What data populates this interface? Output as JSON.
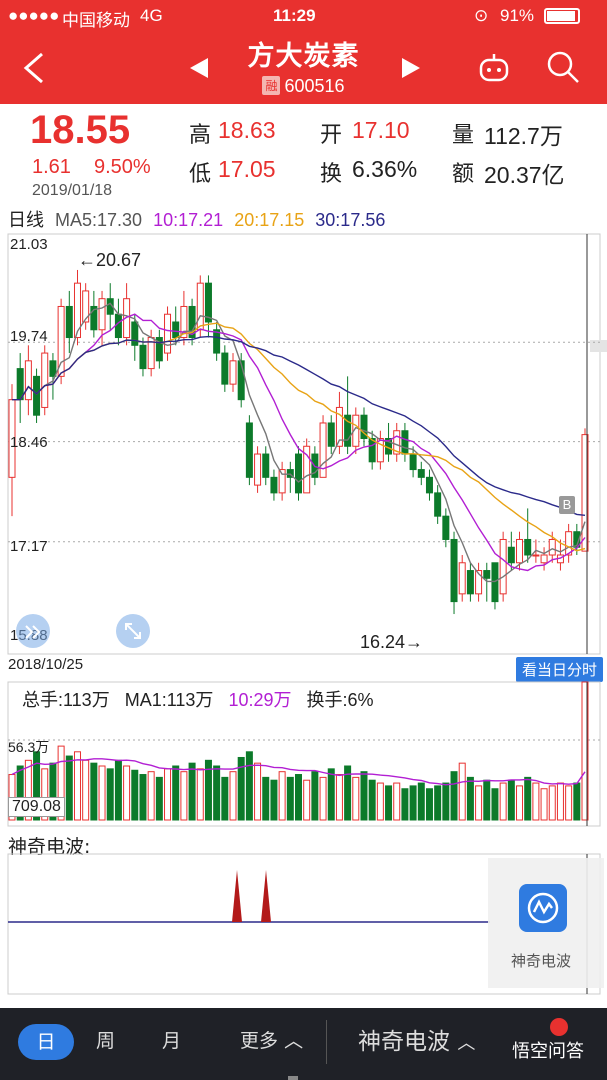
{
  "status_bar": {
    "carrier": "中国移动",
    "network": "4G",
    "time": "11:29",
    "battery": "91%"
  },
  "header": {
    "title": "方大炭素",
    "margin_badge": "融",
    "code": "600516"
  },
  "quote": {
    "price": "18.55",
    "change": "1.61",
    "change_pct": "9.50%",
    "date": "2019/01/18",
    "high_label": "高",
    "high": "18.63",
    "low_label": "低",
    "low": "17.05",
    "open_label": "开",
    "open": "17.10",
    "turnover_label": "换",
    "turnover": "6.36%",
    "volume_label": "量",
    "volume": "112.7万",
    "amount_label": "额",
    "amount": "20.37亿"
  },
  "ma_bar": {
    "period": "日线",
    "ma5": "MA5:17.30",
    "ma10": "10:17.21",
    "ma20": "20:17.15",
    "ma30": "30:17.56"
  },
  "chart_data": {
    "type": "candlestick",
    "y_ticks": [
      "21.03",
      "19.74",
      "18.46",
      "17.17",
      "15.88"
    ],
    "ylim": [
      15.88,
      21.03
    ],
    "annotations": {
      "high": "←20.67",
      "low": "16.24→",
      "marker": "B"
    },
    "start_date": "2018/10/25",
    "candles": [
      [
        18.0,
        19.0,
        19.2,
        17.5
      ],
      [
        19.4,
        19.0,
        19.6,
        18.7
      ],
      [
        19.0,
        19.5,
        19.7,
        18.8
      ],
      [
        19.3,
        18.8,
        19.4,
        18.7
      ],
      [
        18.9,
        19.6,
        19.7,
        18.8
      ],
      [
        19.5,
        19.3,
        19.6,
        19.0
      ],
      [
        19.3,
        20.2,
        20.3,
        19.2
      ],
      [
        20.2,
        19.8,
        20.4,
        19.6
      ],
      [
        19.8,
        20.5,
        20.67,
        19.7
      ],
      [
        20.0,
        20.4,
        20.5,
        19.9
      ],
      [
        20.2,
        19.9,
        20.4,
        19.8
      ],
      [
        19.9,
        20.3,
        20.4,
        19.7
      ],
      [
        20.3,
        20.1,
        20.5,
        19.9
      ],
      [
        20.1,
        19.8,
        20.3,
        19.7
      ],
      [
        19.8,
        20.3,
        20.5,
        19.7
      ],
      [
        20.0,
        19.7,
        20.1,
        19.5
      ],
      [
        19.7,
        19.4,
        19.8,
        19.3
      ],
      [
        19.4,
        19.8,
        19.9,
        19.3
      ],
      [
        19.8,
        19.5,
        19.9,
        19.4
      ],
      [
        19.6,
        20.1,
        20.2,
        19.5
      ],
      [
        20.0,
        19.8,
        20.2,
        19.7
      ],
      [
        19.8,
        20.2,
        20.4,
        19.7
      ],
      [
        20.2,
        19.8,
        20.3,
        19.7
      ],
      [
        19.9,
        20.5,
        20.6,
        19.8
      ],
      [
        20.5,
        20.0,
        20.6,
        19.8
      ],
      [
        19.9,
        19.6,
        20.0,
        19.5
      ],
      [
        19.6,
        19.2,
        19.7,
        19.1
      ],
      [
        19.2,
        19.5,
        19.6,
        19.1
      ],
      [
        19.5,
        19.0,
        19.6,
        18.9
      ],
      [
        18.7,
        18.0,
        18.8,
        17.9
      ],
      [
        17.9,
        18.3,
        18.4,
        17.8
      ],
      [
        18.3,
        18.0,
        18.4,
        17.9
      ],
      [
        18.0,
        17.8,
        18.1,
        17.7
      ],
      [
        17.8,
        18.1,
        18.2,
        17.7
      ],
      [
        18.1,
        18.0,
        18.2,
        17.8
      ],
      [
        18.3,
        17.8,
        18.4,
        17.7
      ],
      [
        17.8,
        18.4,
        18.5,
        17.8
      ],
      [
        18.3,
        18.0,
        18.4,
        17.9
      ],
      [
        18.0,
        18.7,
        18.8,
        18.0
      ],
      [
        18.7,
        18.4,
        18.8,
        18.3
      ],
      [
        18.4,
        18.9,
        19.1,
        18.3
      ],
      [
        18.8,
        18.4,
        19.3,
        18.3
      ],
      [
        18.4,
        18.8,
        18.9,
        18.3
      ],
      [
        18.8,
        18.5,
        18.9,
        18.4
      ],
      [
        18.5,
        18.2,
        18.6,
        18.1
      ],
      [
        18.2,
        18.5,
        18.6,
        18.1
      ],
      [
        18.5,
        18.3,
        18.7,
        18.2
      ],
      [
        18.3,
        18.6,
        18.7,
        18.2
      ],
      [
        18.6,
        18.3,
        18.7,
        18.2
      ],
      [
        18.3,
        18.1,
        18.4,
        18.0
      ],
      [
        18.1,
        18.0,
        18.2,
        17.9
      ],
      [
        18.0,
        17.8,
        18.1,
        17.7
      ],
      [
        17.8,
        17.5,
        17.9,
        17.4
      ],
      [
        17.5,
        17.2,
        17.6,
        17.1
      ],
      [
        17.2,
        16.4,
        17.3,
        16.24
      ],
      [
        16.5,
        16.9,
        17.0,
        16.4
      ],
      [
        16.8,
        16.5,
        16.9,
        16.4
      ],
      [
        16.5,
        16.8,
        16.9,
        16.4
      ],
      [
        16.8,
        16.7,
        16.9,
        16.4
      ],
      [
        16.9,
        16.4,
        16.9,
        16.3
      ],
      [
        16.5,
        17.2,
        17.3,
        16.4
      ],
      [
        17.1,
        16.9,
        17.3,
        16.8
      ],
      [
        16.9,
        17.2,
        17.3,
        16.8
      ],
      [
        17.2,
        17.0,
        17.6,
        16.9
      ],
      [
        17.0,
        17.0,
        17.2,
        16.9
      ],
      [
        16.9,
        17.0,
        17.1,
        16.8
      ],
      [
        17.0,
        17.2,
        17.3,
        16.9
      ],
      [
        16.9,
        17.0,
        17.2,
        16.8
      ],
      [
        17.0,
        17.3,
        17.4,
        16.9
      ],
      [
        17.3,
        17.1,
        17.4,
        17.0
      ],
      [
        17.05,
        18.55,
        18.63,
        17.05
      ]
    ]
  },
  "volume_bar": {
    "total": "总手:113万",
    "ma1": "MA1:113万",
    "ma10": "10:29万",
    "turnover": "换手:6%",
    "max": "56.3万",
    "current": "709.08"
  },
  "volume_data": [
    32,
    38,
    42,
    48,
    36,
    40,
    52,
    45,
    48,
    42,
    40,
    38,
    36,
    42,
    38,
    35,
    32,
    34,
    30,
    36,
    38,
    34,
    40,
    36,
    42,
    38,
    30,
    34,
    44,
    48,
    40,
    30,
    28,
    34,
    30,
    32,
    28,
    34,
    30,
    36,
    32,
    38,
    30,
    34,
    28,
    26,
    24,
    26,
    22,
    24,
    26,
    22,
    24,
    26,
    34,
    40,
    30,
    24,
    28,
    22,
    26,
    28,
    24,
    30,
    26,
    22,
    24,
    26,
    24,
    26,
    109
  ],
  "wave": {
    "title": "神奇电波:",
    "button_label": "神奇电波"
  },
  "end_date": "2018/10/25",
  "intraday_button": "看当日分时",
  "bottom_bar": {
    "day": "日",
    "week": "周",
    "month": "月",
    "more": "更多",
    "wave": "神奇电波"
  },
  "watermark": "悟空问答",
  "colors": {
    "up": "#e8312f",
    "down": "#0c7a2a",
    "ma5": "#777777",
    "ma10": "#b21fd3",
    "ma20": "#e8a316",
    "ma30": "#2b2a8a",
    "accent": "#2f7be0"
  }
}
